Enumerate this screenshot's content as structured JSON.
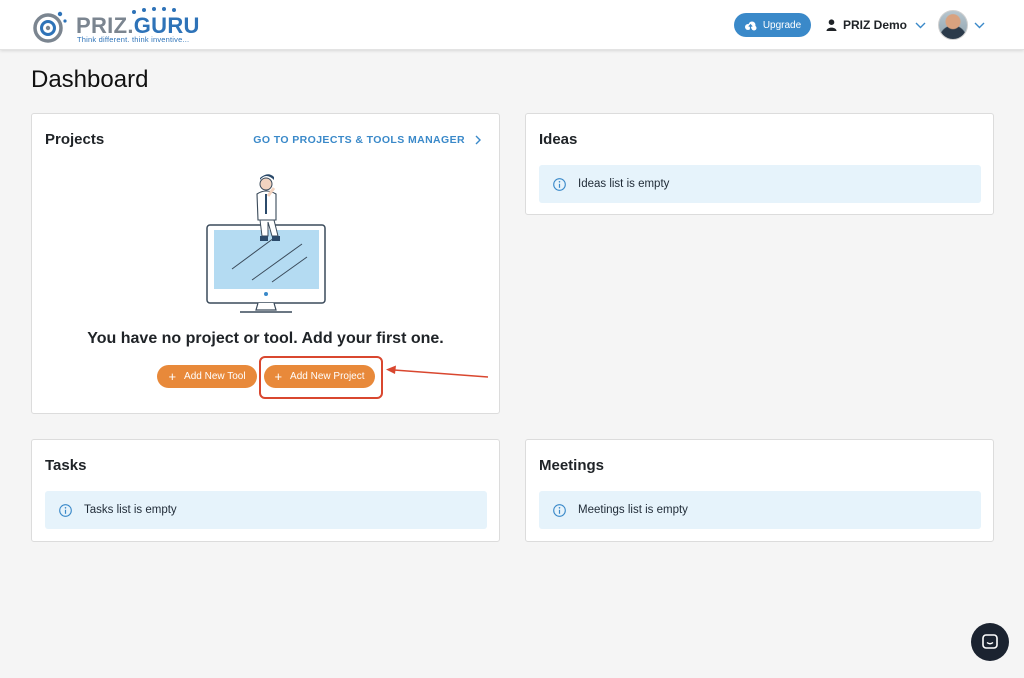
{
  "header": {
    "logo": {
      "name_part1": "PRIZ",
      "name_part2": "GURU",
      "tagline": "Think different. think inventive..."
    },
    "upgrade_label": "Upgrade",
    "user_name": "PRIZ Demo"
  },
  "page": {
    "title": "Dashboard"
  },
  "projects": {
    "title": "Projects",
    "link_label": "GO TO PROJECTS & TOOLS MANAGER",
    "empty_message": "You have no project or tool. Add your first one.",
    "add_tool_label": "Add New Tool",
    "add_project_label": "Add New Project"
  },
  "ideas": {
    "title": "Ideas",
    "empty_message": "Ideas list is empty"
  },
  "tasks": {
    "title": "Tasks",
    "empty_message": "Tasks list is empty"
  },
  "meetings": {
    "title": "Meetings",
    "empty_message": "Meetings list is empty"
  },
  "colors": {
    "brand_blue": "#3a89c9",
    "accent_orange": "#e8893a",
    "info_bg": "#e6f3fb",
    "annotation_red": "#d9472f"
  },
  "icons": [
    "logo-mark-icon",
    "cloud-upgrade-icon",
    "user-icon",
    "chevron-down-icon",
    "chevron-right-icon",
    "info-icon",
    "plus-icon",
    "chat-icon",
    "arrow-annotation-icon"
  ]
}
